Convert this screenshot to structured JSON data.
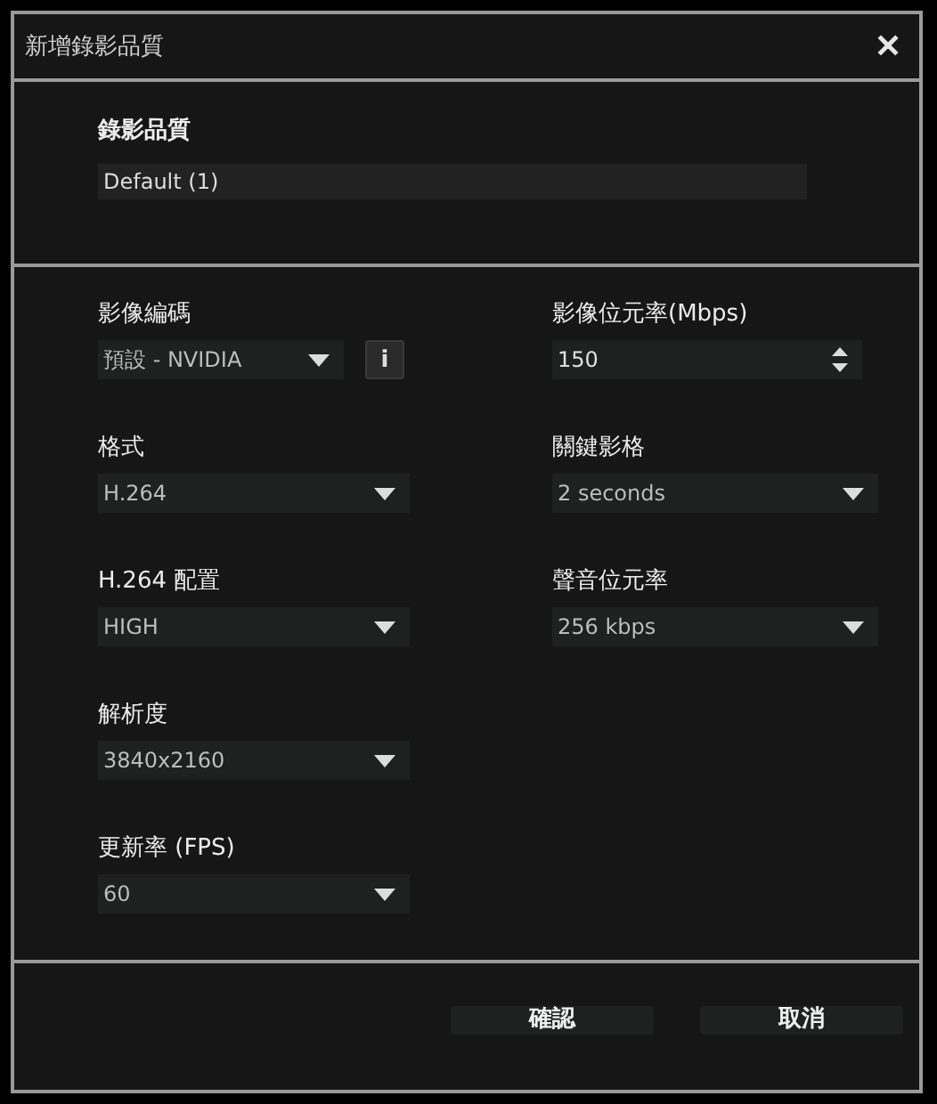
{
  "window": {
    "title": "新增錄影品質",
    "close": "✕"
  },
  "quality": {
    "label": "錄影品質",
    "value": "Default (1)"
  },
  "left_fields": [
    {
      "label": "影像編碼",
      "kind": "dropdown",
      "value": "預設 - NVIDIA",
      "info_button": "i"
    },
    {
      "label": "格式",
      "kind": "dropdown",
      "value": "H.264"
    },
    {
      "label": "H.264 配置",
      "kind": "dropdown",
      "value": "HIGH"
    },
    {
      "label": "解析度",
      "kind": "dropdown",
      "value": "3840x2160"
    },
    {
      "label": "更新率 (FPS)",
      "kind": "dropdown",
      "value": "60"
    }
  ],
  "right_fields": [
    {
      "label": "影像位元率(Mbps)",
      "kind": "spinner",
      "value": "150"
    },
    {
      "label": "關鍵影格",
      "kind": "dropdown",
      "value": "2 seconds"
    },
    {
      "label": "聲音位元率",
      "kind": "dropdown",
      "value": "256 kbps"
    }
  ],
  "buttons": [
    "確認",
    "取消"
  ]
}
